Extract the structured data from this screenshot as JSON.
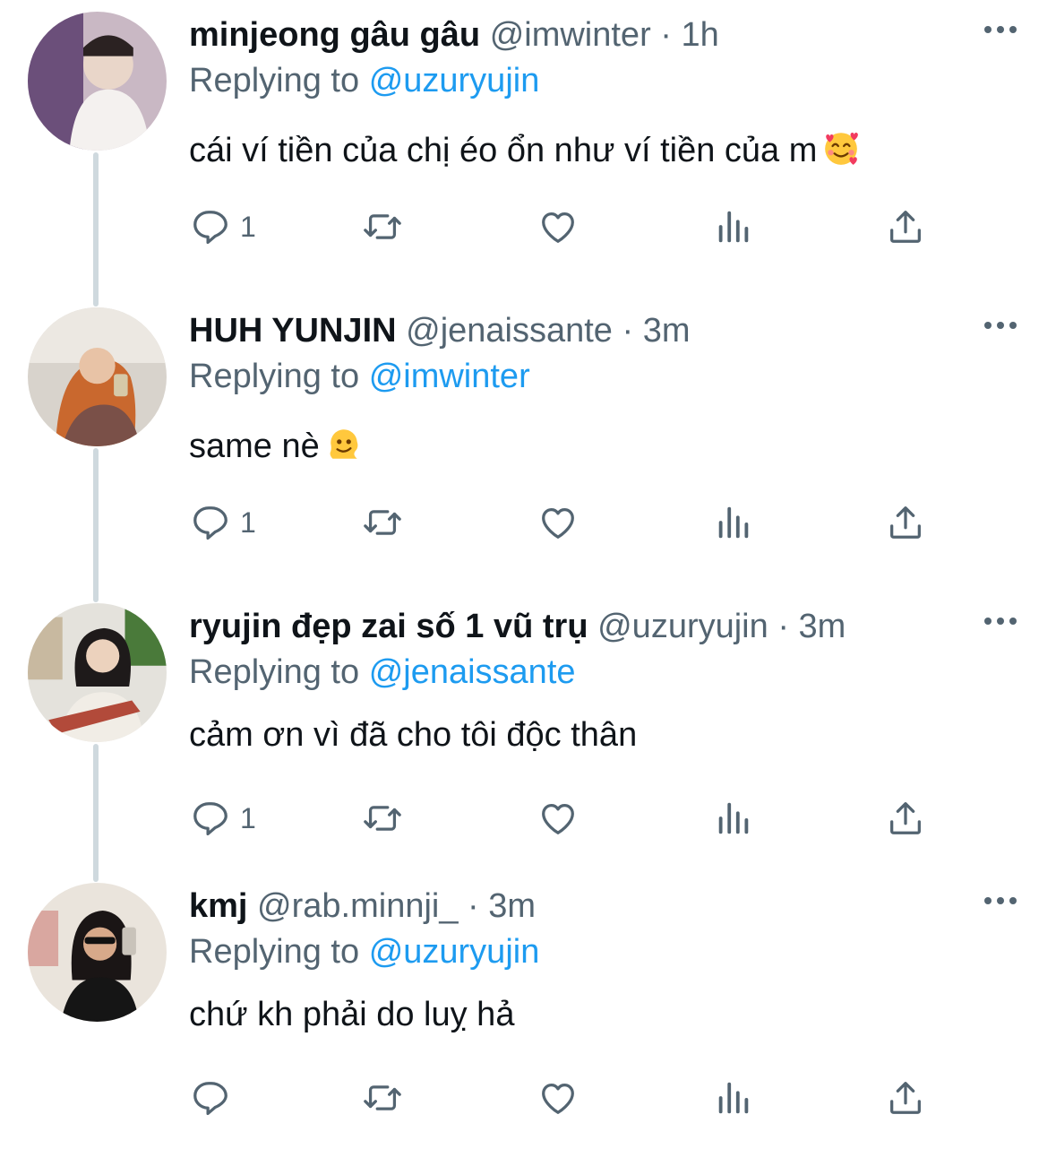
{
  "tweets": [
    {
      "name": "minjeong gâu gâu",
      "handle": "@imwinter",
      "separator": "·",
      "time": "1h",
      "replying_prefix": "Replying to",
      "replying_to": "@uzuryujin",
      "text": "cái ví tiền của chị éo ổn như ví tiền của m",
      "emoji": "smiling-face-with-hearts",
      "reply_count": "1"
    },
    {
      "name": "HUH YUNJIN",
      "handle": "@jenaissante",
      "separator": "·",
      "time": "3m",
      "replying_prefix": "Replying to",
      "replying_to": "@imwinter",
      "text": "same nè",
      "emoji": "melting-face",
      "reply_count": "1"
    },
    {
      "name": "ryujin đẹp zai số 1 vũ trụ",
      "handle": "@uzuryujin",
      "separator": "·",
      "time": "3m",
      "replying_prefix": "Replying to",
      "replying_to": "@jenaissante",
      "text": "cảm ơn vì đã cho tôi độc thân",
      "emoji": "",
      "reply_count": "1"
    },
    {
      "name": "kmj",
      "handle": "@rab.minnji_",
      "separator": "·",
      "time": "3m",
      "replying_prefix": "Replying to",
      "replying_to": "@uzuryujin",
      "text": "chứ kh phải do luỵ hả",
      "emoji": "",
      "reply_count": ""
    }
  ],
  "icons": {
    "reply": "reply-icon",
    "retweet": "retweet-icon",
    "like": "heart-icon",
    "views": "views-icon",
    "share": "share-icon",
    "more": "more-icon"
  },
  "colors": {
    "text": "#0f1419",
    "secondary": "#536471",
    "mention": "#1d9bf0",
    "thread_line": "#cfd9de"
  }
}
